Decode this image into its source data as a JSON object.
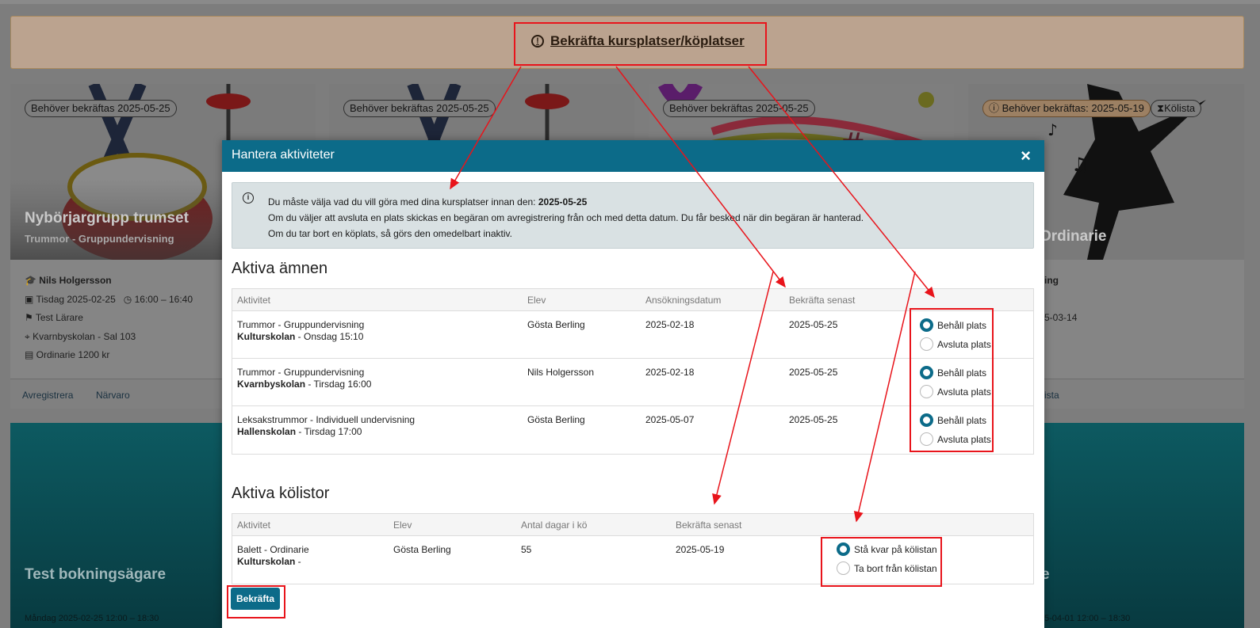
{
  "banner": {
    "icon": "exclamation-circle-icon",
    "text": "Bekräfta kursplatser/köplatser"
  },
  "cards": [
    {
      "badge": "Behöver bekräftas 2025-05-25",
      "title": "Nybörjargrupp trumset",
      "subtitle": "Trummor - Gruppundervisning",
      "teacher": "Nils Holgersson",
      "date": "Tisdag 2025-02-25",
      "time": "16:00 – 16:40",
      "instructor": "Test Lärare",
      "location": "Kvarnbyskolan - Sal 103",
      "price": "Ordinarie 1200 kr",
      "links": [
        "Avregistrera",
        "Närvaro"
      ]
    },
    {
      "badge": "Behöver bekräftas 2025-05-25"
    },
    {
      "badge": "Behöver bekräftas 2025-05-25"
    },
    {
      "badge": "Behöver bekräftas: 2025-05-19",
      "badge2": "Kölista",
      "title_fragment": "Ordinarie",
      "meta_fragment_1": "ing",
      "meta_fragment_2": "5-03-14",
      "link_fragment": "ista"
    }
  ],
  "bottom_cards": [
    {
      "title": "Test bokningsägare",
      "meta": "Måndag 2025-02-25   12:00 – 18:30"
    },
    {
      "title_fragment": "e",
      "meta": "5-04-01   12:00 – 18:30"
    }
  ],
  "modal": {
    "title": "Hantera aktiviteter",
    "close_icon": "close-icon",
    "info": {
      "line1_prefix": "Du måste välja vad du vill göra med dina kursplatser innan den: ",
      "line1_date": "2025-05-25",
      "line2": "Om du väljer att avsluta en plats skickas en begäran om avregistrering från och med detta datum. Du får besked när din begäran är hanterad.",
      "line3": "Om du tar bort en köplats, så görs den omedelbart inaktiv."
    },
    "active_subjects": {
      "title": "Aktiva ämnen",
      "headers": [
        "Aktivitet",
        "Elev",
        "Ansökningsdatum",
        "Bekräfta senast"
      ],
      "rows": [
        {
          "activity": "Trummor - Gruppundervisning",
          "school": "Kulturskolan",
          "schedule": " - Onsdag 15:10",
          "student": "Gösta Berling",
          "applied": "2025-02-18",
          "confirm_by": "2025-05-25",
          "opt_keep": "Behåll plats",
          "opt_end": "Avsluta plats",
          "selected": "keep"
        },
        {
          "activity": "Trummor - Gruppundervisning",
          "school": "Kvarnbyskolan",
          "schedule": " - Tirsdag 16:00",
          "student": "Nils Holgersson",
          "applied": "2025-02-18",
          "confirm_by": "2025-05-25",
          "opt_keep": "Behåll plats",
          "opt_end": "Avsluta plats",
          "selected": "keep"
        },
        {
          "activity": "Leksakstrummor - Individuell undervisning",
          "school": "Hallenskolan",
          "schedule": " - Tirsdag 17:00",
          "student": "Gösta Berling",
          "applied": "2025-05-07",
          "confirm_by": "2025-05-25",
          "opt_keep": "Behåll plats",
          "opt_end": "Avsluta plats",
          "selected": "keep"
        }
      ]
    },
    "active_queues": {
      "title": "Aktiva kölistor",
      "headers": [
        "Aktivitet",
        "Elev",
        "Antal dagar i kö",
        "Bekräfta senast"
      ],
      "rows": [
        {
          "activity": "Balett - Ordinarie",
          "school": "Kulturskolan",
          "schedule": " -",
          "student": "Gösta Berling",
          "days": "55",
          "confirm_by": "2025-05-19",
          "opt_stay": "Stå kvar på kölistan",
          "opt_remove": "Ta bort från kölistan",
          "selected": "stay"
        }
      ]
    },
    "confirm_button": "Bekräfta"
  },
  "colors": {
    "modal_header": "#0c6b89",
    "annotation": "#e8141b",
    "radio_selected": "#0c6b89"
  }
}
